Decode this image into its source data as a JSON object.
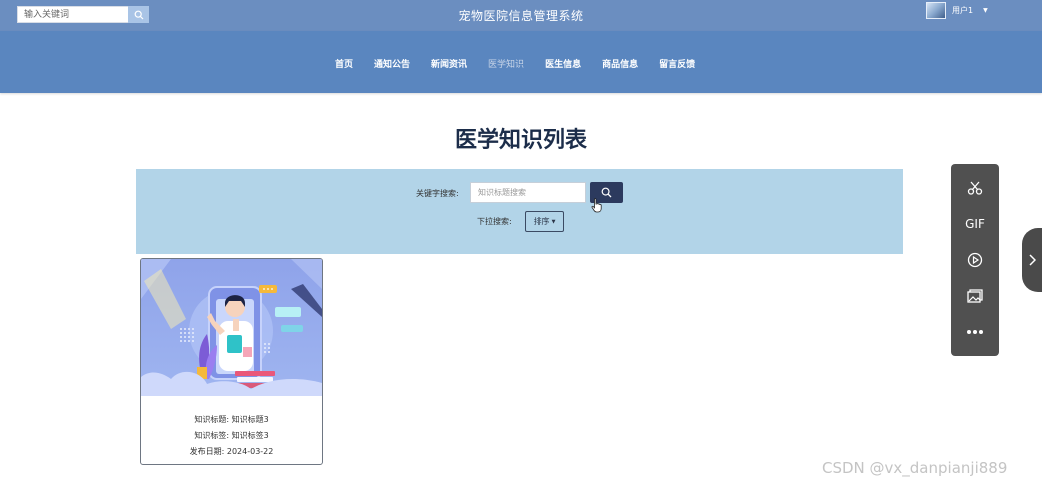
{
  "topbar": {
    "search_placeholder": "输入关键词",
    "site_title": "宠物医院信息管理系统",
    "user_name": "用户1"
  },
  "nav": {
    "items": [
      "首页",
      "通知公告",
      "新闻资讯",
      "医学知识",
      "医生信息",
      "商品信息",
      "留言反馈"
    ],
    "active_item": "医学知识"
  },
  "page": {
    "title": "医学知识列表"
  },
  "search_panel": {
    "keyword_label": "关键字搜索:",
    "keyword_placeholder": "知识标题搜索",
    "dropdown_label": "下拉搜索:",
    "sort_label": "排序"
  },
  "cards": [
    {
      "title_line": "知识标题: 知识标题3",
      "tag_line": "知识标签: 知识标签3",
      "date_line": "发布日期: 2024-03-22"
    }
  ],
  "toolbar": {
    "icons": [
      "scissors-icon",
      "gif-icon",
      "play-icon",
      "image-icon",
      "more-icon"
    ],
    "gif_label": "GIF"
  },
  "watermark": "CSDN @vx_danpianji889",
  "colors": {
    "topbar": "#6b8ec0",
    "navbar": "#5a86bf",
    "search_panel": "#b2d4e8",
    "search_button": "#2c3a5e",
    "toolbar": "#505050"
  }
}
